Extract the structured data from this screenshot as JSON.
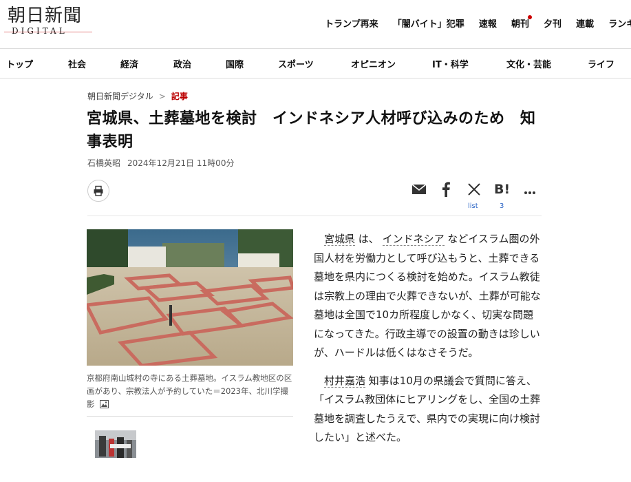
{
  "site": {
    "logo_main": "朝日新聞",
    "logo_sub": "DIGITAL"
  },
  "topnav": [
    "トランプ再来",
    "「闇バイト」犯罪",
    "速報",
    "朝刊",
    "夕刊",
    "連載",
    "ランキング"
  ],
  "catnav": [
    "トップ",
    "社会",
    "経済",
    "政治",
    "国際",
    "スポーツ",
    "オピニオン",
    "IT・科学",
    "文化・芸能",
    "ライフ"
  ],
  "breadcrumb": {
    "home": "朝日新聞デジタル",
    "separator": ">",
    "current": "記事"
  },
  "article": {
    "headline": "宮城県、土葬墓地を検討　インドネシア人材呼び込みのため　知事表明",
    "author": "石橋英昭",
    "date": "2024年12月21日 11時00分",
    "photo_caption": "京都府南山城村の寺にある土葬墓地。イスラム教地区の区画があり、宗教法人が予約していた＝2023年、北川学撮影",
    "para1": {
      "kw1": "宮城県",
      "t1": " は、 ",
      "kw2": "インドネシア",
      "t2": " などイスラム圏の外国人材を労働力として呼び込もうと、土葬できる墓地を県内につくる検討を始めた。イスラム教徒は宗教上の理由で火葬できないが、土葬が可能な墓地は全国で10カ所程度しかなく、切実な問題になってきた。行政主導での設置の動きは珍しいが、ハードルは低くはなさそうだ。"
    },
    "para2": {
      "kw1": "村井嘉浩",
      "t1": " 知事は10月の県議会で質問に答え、「イスラム教団体にヒアリングをし、全国の土葬墓地を調査したうえで、県内での実現に向け検討したい」と述べた。"
    }
  },
  "share": {
    "list_label": "list",
    "hatena_count": "3",
    "hatena_label": "B!"
  },
  "icons": [
    "print-icon",
    "mail-icon",
    "facebook-icon",
    "x-icon",
    "hatena-icon",
    "more-icon",
    "photo-icon"
  ],
  "colors": {
    "accent": "#cc0000",
    "link": "#2a64c5"
  }
}
